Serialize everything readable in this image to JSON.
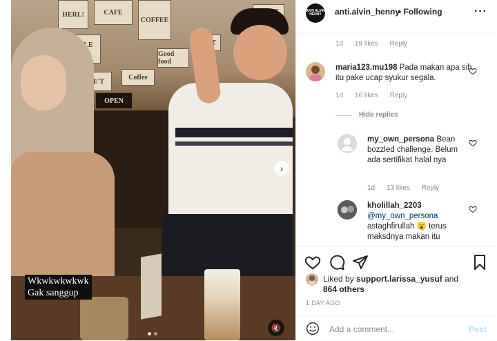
{
  "media": {
    "posters": [
      "HERL!",
      "COFFEE",
      "CAFE",
      "WAFFLE MILK",
      "WE'T",
      "OPEN",
      "DENT",
      "Good food",
      "Coffee",
      "HOME"
    ],
    "caption_line1": "Wkwkwkwkwk",
    "caption_line2": "Gak sanggup",
    "next_arrow": "›",
    "mute_icon": "🔇"
  },
  "header": {
    "logo_text": "ANTI ALVIN HENNY",
    "username": "anti.alvin_henny",
    "following": "• Following",
    "more": "···"
  },
  "comments": [
    {
      "time": "1d",
      "likes": "19 likes",
      "reply": "Reply"
    },
    {
      "username": "maria123.mu198",
      "text": "Pada makan apa sih itu pake ucap syukur segala.",
      "time": "1d",
      "likes": "16 likes",
      "reply": "Reply"
    }
  ],
  "hide_replies": "Hide replies",
  "replies": [
    {
      "username": "my_own_persona",
      "text": "Bean bozzled challenge. Belum ada sertifikat halal nya",
      "time": "1d",
      "likes": "13 likes",
      "reply": "Reply"
    },
    {
      "username": "kholillah_2203",
      "mention": "@my_own_persona",
      "text": "astaghfirullah 😮 terus maksdnya makan itu"
    }
  ],
  "likes": {
    "prefix": "Liked by ",
    "user": "support.larissa_yusuf",
    "middle": " and",
    "count": "864 others"
  },
  "timeago": "1 DAY AGO",
  "composer": {
    "placeholder": "Add a comment...",
    "post": "Post"
  },
  "colors": {
    "link": "#00376b",
    "post_disabled": "#b2dffc",
    "muted_text": "#8e8e8e"
  }
}
